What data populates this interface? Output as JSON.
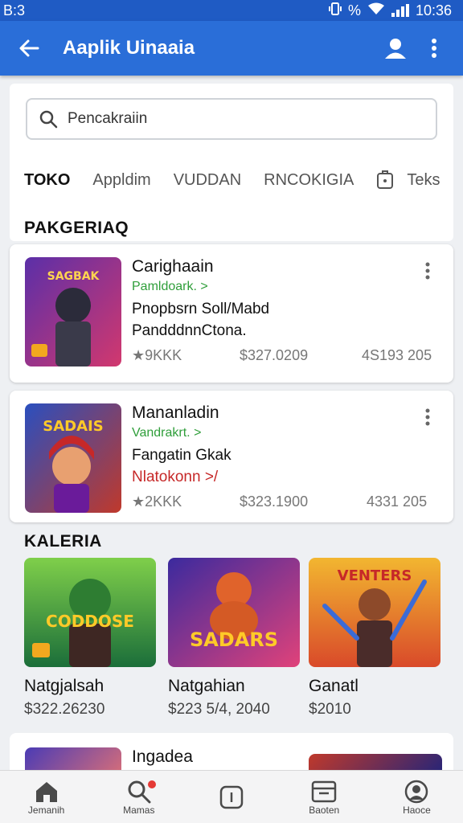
{
  "status_bar": {
    "time": "B:3",
    "clock": "10:36",
    "percent": "%"
  },
  "app_bar": {
    "title": "Aaplik Uinaaia"
  },
  "search": {
    "placeholder": "Pencakraiin"
  },
  "tabs": [
    {
      "label": "TOKO"
    },
    {
      "label": "Appldim"
    },
    {
      "label": "VUDDAN"
    },
    {
      "label": "RNCOKIGIA"
    },
    {
      "label": "Teks"
    }
  ],
  "sections": {
    "first": "PAKGERIAQ",
    "second": "KALERIA"
  },
  "cards": [
    {
      "thumb_text": "SAGBAK",
      "name": "Carighaain",
      "developer": "Pamldoark. >",
      "desc1": "Pnopbsrn Soll/Mabd",
      "desc2": "PandddnnCtona.",
      "rating": "★9KKK",
      "price": "$327.0209",
      "downloads": "4S193 205",
      "colors": {
        "bg1": "#5b2fa8",
        "bg2": "#d2386e"
      }
    },
    {
      "thumb_text": "SADAIS",
      "name": "Mananladin",
      "developer": "Vandrakrt. >",
      "desc1": "Fangatin Gkak",
      "desc2": "Nlatokonn >/",
      "rating": "★2KKK",
      "price": "$323.1900",
      "downloads": "4331 205",
      "colors": {
        "bg1": "#2a4fbf",
        "bg2": "#c0392b"
      }
    }
  ],
  "grid": [
    {
      "thumb_text": "CODDOSE",
      "name": "Natgjalsah",
      "price": "$322.26230",
      "colors": {
        "bg1": "#1b6e3a",
        "bg2": "#7fcf4a"
      }
    },
    {
      "thumb_text": "SADARS",
      "name": "Natgahian",
      "price": "$223 5/4, 2040",
      "colors": {
        "bg1": "#3b2a9e",
        "bg2": "#e0427a"
      }
    },
    {
      "thumb_text": "VENTERS",
      "name": "Ganatl",
      "price": "$2010",
      "colors": {
        "bg1": "#d94a2a",
        "bg2": "#f2b630"
      }
    }
  ],
  "partial": {
    "name": "Ingadea"
  },
  "bottom_nav": [
    {
      "label": "Jemanih",
      "icon": "home-icon"
    },
    {
      "label": "Mamas",
      "icon": "search-icon"
    },
    {
      "label": "",
      "icon": "info-icon"
    },
    {
      "label": "Baoten",
      "icon": "inbox-icon"
    },
    {
      "label": "Haoce",
      "icon": "account-icon"
    }
  ],
  "accent": "#2a6ed8"
}
